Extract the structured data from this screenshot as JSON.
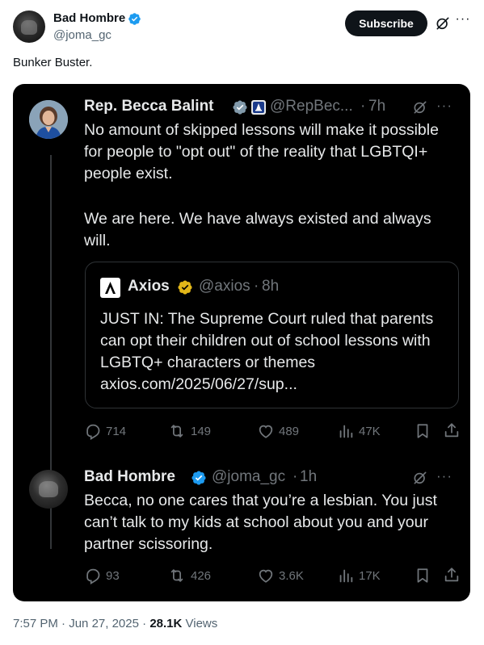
{
  "post": {
    "author_name": "Bad Hombre",
    "author_handle": "@joma_gc",
    "subscribe_label": "Subscribe",
    "text": "Bunker Buster.",
    "time": "7:57 PM",
    "date": "Jun 27, 2025",
    "views_count": "28.1K",
    "views_label": "Views"
  },
  "embed": {
    "tweet1": {
      "author_name": "Rep. Becca Balint",
      "author_handle": "@RepBec...",
      "time": "7h",
      "body_p1": "No amount of skipped lessons will make it possible for people to \"opt out\" of the reality that LGBTQI+ people exist.",
      "body_p2": "We are here. We have always existed and always will.",
      "quote": {
        "author_name": "Axios",
        "author_handle": "@axios",
        "time": "8h",
        "body": "JUST IN:  The Supreme Court ruled that parents can opt their children out of school lessons with LGBTQ+ characters or themes axios.com/2025/06/27/sup..."
      },
      "replies": "714",
      "reposts": "149",
      "likes": "489",
      "views": "47K"
    },
    "tweet2": {
      "author_name": "Bad Hombre",
      "author_handle": "@joma_gc",
      "time": "1h",
      "body": "Becca, no one cares that you’re a lesbian. You just can’t talk to my kids at school about you and your partner scissoring.",
      "replies": "93",
      "reposts": "426",
      "likes": "3.6K",
      "views": "17K"
    }
  },
  "colors": {
    "verified_blue": "#1d9bf0",
    "verified_gold": "#e2b719",
    "dark_bg": "#000000",
    "muted_text": "#71767b"
  },
  "icons": [
    "verified-badge-icon",
    "grok-icon",
    "more-icon",
    "government-badge-icon",
    "reply-icon",
    "repost-icon",
    "like-icon",
    "views-icon",
    "bookmark-icon",
    "share-icon",
    "axios-logo-icon"
  ],
  "separator": "·"
}
